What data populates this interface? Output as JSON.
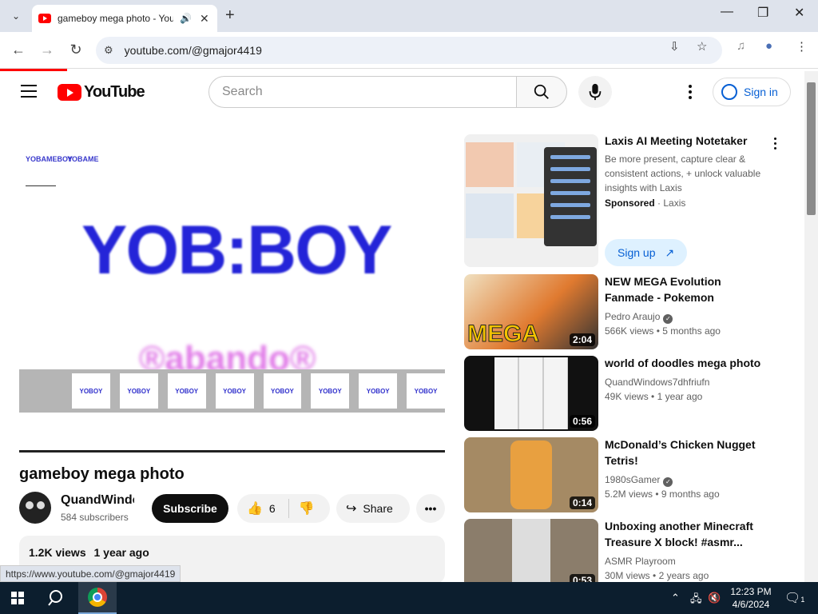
{
  "browser": {
    "tab_title": "gameboy mega photo - YouTube",
    "url": "youtube.com/@gmajor4419",
    "status_url": "https://www.youtube.com/@gmajor4419"
  },
  "masthead": {
    "logo_text": "YouTube",
    "search_placeholder": "Search",
    "signin_label": "Sign in"
  },
  "player": {
    "big_text": "YOB:BOY",
    "purple_text": "®abando®",
    "small_logo_1": "YOBAMEBOY",
    "small_logo_2": "YOBAME"
  },
  "video": {
    "title": "gameboy mega photo",
    "channel_name": "QuandWindo",
    "subscribers": "584 subscribers",
    "subscribe_label": "Subscribe",
    "likes": "6",
    "share_label": "Share",
    "views": "1.2K views",
    "age": "1 year ago"
  },
  "sidebar": {
    "ad": {
      "title": "Laxis AI Meeting Notetaker",
      "description": "Be more present, capture clear & consistent actions, + unlock valuable insights with Laxis",
      "sponsored": "Sponsored",
      "advertiser": "Laxis",
      "cta": "Sign up"
    },
    "items": [
      {
        "title": "NEW MEGA Evolution Fanmade - Pokemon",
        "channel": "Pedro Araujo",
        "verified": true,
        "views": "566K views",
        "age": "5 months ago",
        "duration": "2:04",
        "thumb_text": "MEGA"
      },
      {
        "title": "world of doodles mega photo",
        "channel": "QuandWindows7dhfriufn",
        "verified": false,
        "views": "49K views",
        "age": "1 year ago",
        "duration": "0:56"
      },
      {
        "title": "McDonald’s Chicken Nugget Tetris!",
        "channel": "1980sGamer",
        "verified": true,
        "views": "5.2M views",
        "age": "9 months ago",
        "duration": "0:14"
      },
      {
        "title": "Unboxing another Minecraft Treasure X block! #asmr...",
        "channel": "ASMR Playroom",
        "verified": false,
        "views": "30M views",
        "age": "2 years ago",
        "duration": "0:53"
      }
    ]
  },
  "taskbar": {
    "time": "12:23 PM",
    "date": "4/6/2024",
    "notification_count": "1"
  }
}
